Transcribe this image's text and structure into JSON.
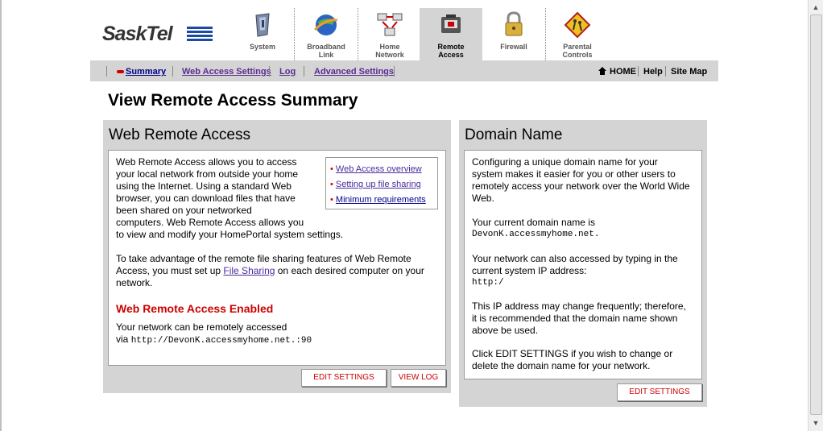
{
  "brand": {
    "name": "SaskTel"
  },
  "tabs": [
    {
      "label_line1": "System",
      "label_line2": ""
    },
    {
      "label_line1": "Broadband",
      "label_line2": "Link"
    },
    {
      "label_line1": "Home",
      "label_line2": "Network"
    },
    {
      "label_line1": "Remote",
      "label_line2": "Access"
    },
    {
      "label_line1": "Firewall",
      "label_line2": ""
    },
    {
      "label_line1": "Parental",
      "label_line2": "Controls"
    }
  ],
  "subnav": {
    "items": [
      "Summary",
      "Web Access Settings",
      "Log",
      "Advanced Settings"
    ],
    "home": "HOME",
    "help": "Help",
    "sitemap": "Site Map"
  },
  "page": {
    "title": "View Remote Access Summary"
  },
  "web_remote": {
    "title": "Web Remote Access",
    "intro_lines": [
      "Web Remote Access allows you to access",
      "your local network from outside your home",
      "using the Internet. Using a standard Web",
      "browser, you can download files that have",
      "been shared on your networked",
      "computers. Web Remote Access allows you",
      "to view and modify your HomePortal system settings."
    ],
    "links": [
      "Web Access overview",
      "Setting up file sharing",
      "Minimum requirements"
    ],
    "para2_line1": "To take advantage of the remote file sharing features of Web Remote",
    "para2_line2_pre": "Access, you must set up ",
    "para2_link": "File Sharing",
    "para2_line2_post": " on each desired computer on your",
    "para2_line3": "network.",
    "status_heading": "Web Remote Access Enabled",
    "status_text": "Your network can be remotely accessed",
    "via": "via",
    "url": "http://DevonK.accessmyhome.net.:90",
    "edit_button": "EDIT SETTINGS",
    "log_button": "VIEW LOG"
  },
  "domain": {
    "title": "Domain Name",
    "p1_lines": [
      "Configuring a unique domain name for your",
      "system makes it easier for you or other users to",
      "remotely access your network over the World Wide",
      "Web."
    ],
    "p2_line": "Your current domain name is",
    "domain_value": "DevonK.accessmyhome.net.",
    "p3_lines": [
      "Your network can also accessed by typing in the",
      "current system IP address:"
    ],
    "ip_value": "http:/",
    "p4_lines": [
      "This IP address may change frequently; therefore,",
      "it is recommended that the domain name shown",
      "above be used."
    ],
    "p5_lines": [
      "Click EDIT SETTINGS if you wish to change or",
      "delete the domain name for your network."
    ],
    "edit_button": "EDIT SETTINGS"
  },
  "colors": {
    "accent_red": "#cc0000",
    "link_purple": "#5a2c93",
    "panel_gray": "#d4d4d4",
    "brand_blue": "#1c4aa0"
  }
}
